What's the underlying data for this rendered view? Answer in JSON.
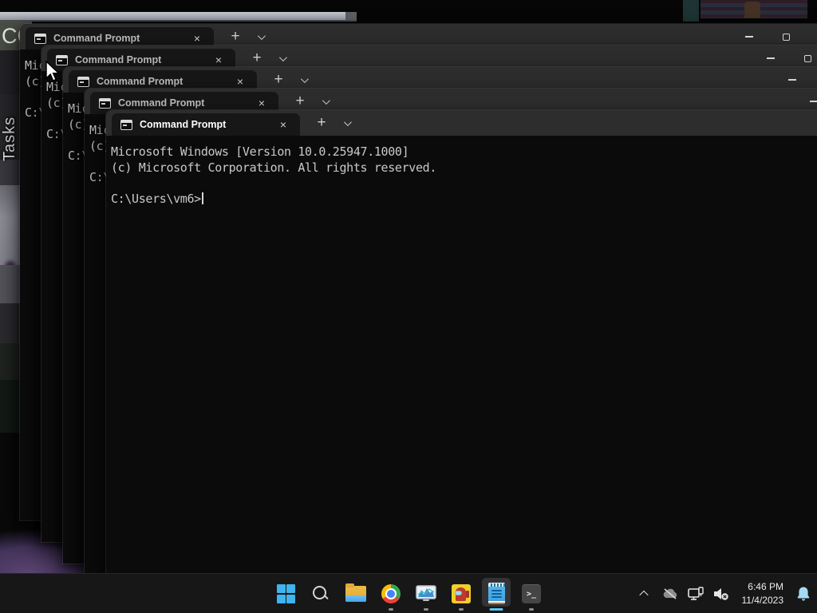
{
  "background": {
    "cc_text": "CC",
    "tasks_label": "Tasks"
  },
  "terminal": {
    "tab_title": "Command Prompt",
    "line1": "Microsoft Windows [Version 10.0.25947.1000]",
    "line2": "(c) Microsoft Corporation. All rights reserved.",
    "prompt": "C:\\Users\\vm6>"
  },
  "titlebar": {
    "tab_close_glyph": "×",
    "new_tab_glyph": "+",
    "window_close_glyph": "×"
  },
  "windows": [
    {
      "tab_title": "Command Prompt"
    },
    {
      "tab_title": "Command Prompt"
    },
    {
      "tab_title": "Command Prompt"
    },
    {
      "tab_title": "Command Prompt"
    },
    {
      "tab_title": "Command Prompt"
    }
  ],
  "taskbar": {
    "items": [
      {
        "name": "start",
        "icon": "windows-logo-icon",
        "running": false,
        "active": false
      },
      {
        "name": "search",
        "icon": "search-icon",
        "running": false,
        "active": false
      },
      {
        "name": "file-explorer",
        "icon": "folder-icon",
        "running": false,
        "active": false
      },
      {
        "name": "chrome",
        "icon": "chrome-icon",
        "running": true,
        "active": false
      },
      {
        "name": "task-manager",
        "icon": "monitor-graph-icon",
        "running": true,
        "active": false
      },
      {
        "name": "among-us",
        "icon": "crewmate-icon",
        "running": true,
        "active": false
      },
      {
        "name": "notepad",
        "icon": "notepad-icon",
        "running": true,
        "active": true
      },
      {
        "name": "terminal",
        "icon": "command-prompt-icon",
        "running": true,
        "active": false
      }
    ]
  },
  "tray": {
    "time": "6:46 PM",
    "date": "11/4/2023",
    "icons": [
      "chevron-up",
      "onedrive-offline",
      "ethernet",
      "volume-muted",
      "notification-bell"
    ]
  }
}
